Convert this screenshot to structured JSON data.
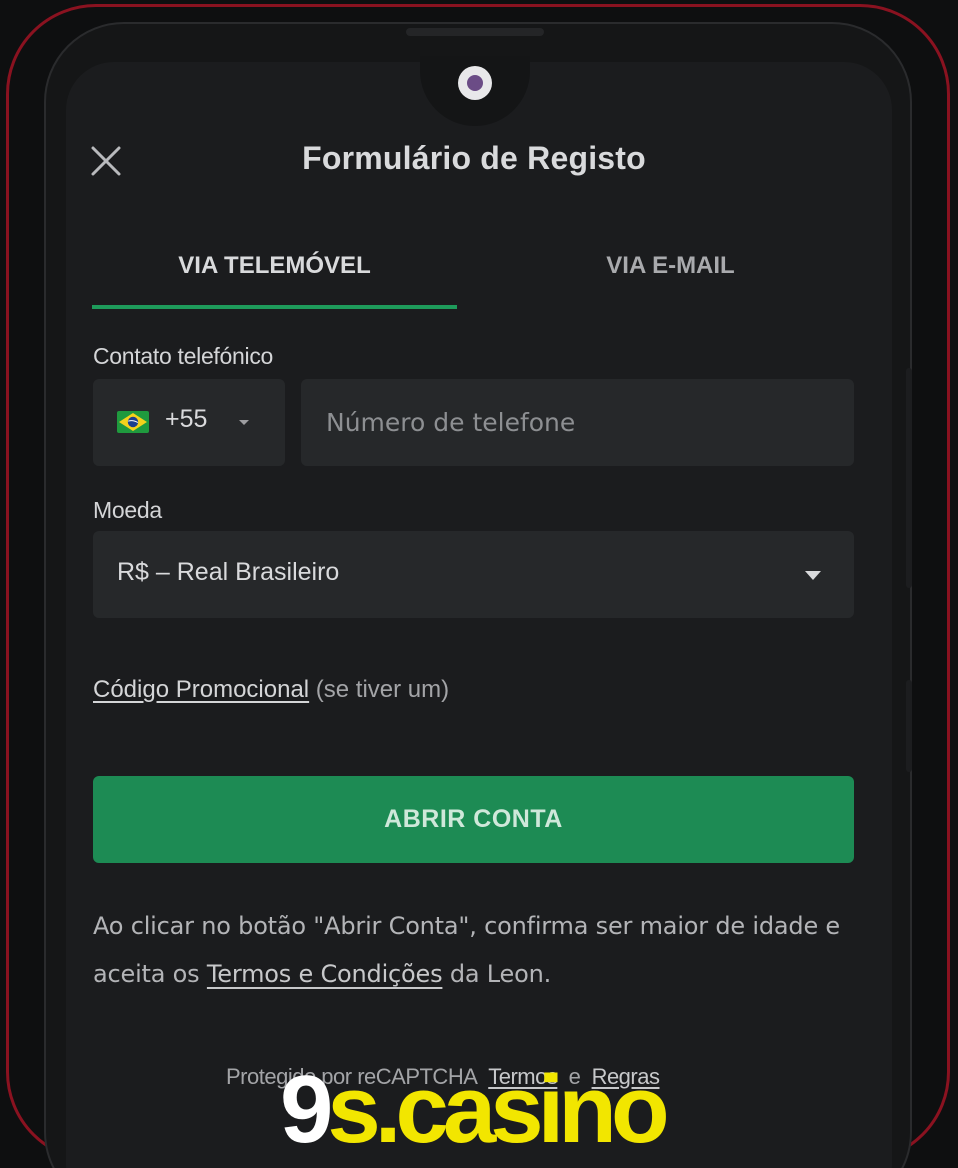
{
  "header": {
    "title": "Formulário de Registo"
  },
  "tabs": [
    {
      "label": "VIA TELEMÓVEL",
      "active": true
    },
    {
      "label": "VIA E-MAIL",
      "active": false
    }
  ],
  "phone": {
    "label": "Contato telefónico",
    "dial_code": "+55",
    "country_flag": "brazil-flag",
    "placeholder": "Número de telefone"
  },
  "currency": {
    "label": "Moeda",
    "selected": "R$ – Real Brasileiro"
  },
  "promo": {
    "link": "Código Promocional",
    "suffix": " (se tiver um)"
  },
  "submit": {
    "label": "ABRIR CONTA"
  },
  "disclaimer": {
    "prefix": "Ao clicar no botão \"Abrir Conta\", confirma ser maior de idade e aceita os ",
    "link": "Termos e Condições",
    "suffix": " da Leon."
  },
  "recaptcha": {
    "prefix": "Protegido por reCAPTCHA",
    "terms": "Termos",
    "and": "e",
    "rules": "Regras"
  },
  "watermark": {
    "number": "9",
    "text": "s.casino"
  },
  "colors": {
    "accent": "#1e9b5b",
    "button": "#1d8b54",
    "frame": "#8a1220",
    "watermark_yellow": "#f2e600"
  }
}
